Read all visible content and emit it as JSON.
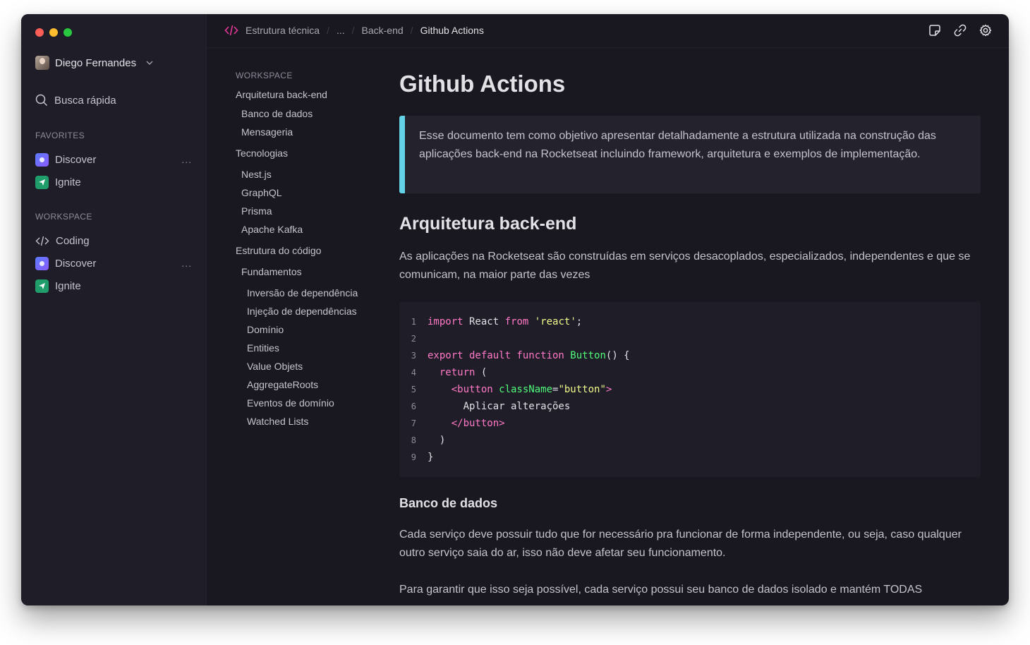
{
  "sidebar": {
    "user_name": "Diego Fernandes",
    "search_label": "Busca rápida",
    "favorites_label": "FAVORITES",
    "favorites": [
      {
        "label": "Discover",
        "icon": "discover-icon",
        "more": "..."
      },
      {
        "label": "Ignite",
        "icon": "ignite-icon"
      }
    ],
    "workspace_label": "WORKSPACE",
    "workspace": [
      {
        "label": "Coding",
        "icon": "code-icon"
      },
      {
        "label": "Discover",
        "icon": "discover-icon",
        "more": "..."
      },
      {
        "label": "Ignite",
        "icon": "ignite-icon"
      }
    ]
  },
  "topbar": {
    "breadcrumb": [
      "Estrutura técnica",
      "...",
      "Back-end",
      "Github Actions"
    ],
    "separator": "/",
    "actions": [
      "note-icon",
      "link-icon",
      "gear-icon"
    ]
  },
  "toc": {
    "label": "WORKSPACE",
    "items": [
      "Arquitetura back-end",
      "Banco de dados",
      "Mensageria",
      "Tecnologias",
      "Nest.js",
      "GraphQL",
      "Prisma",
      "Apache Kafka",
      "Estrutura do código",
      "Fundamentos",
      "Inversão de dependência",
      "Injeção de dependências",
      "Domínio",
      "Entities",
      "Value Objets",
      "AggregateRoots",
      "Eventos de domínio",
      "Watched Lists"
    ]
  },
  "content": {
    "title": "Github Actions",
    "callout": "Esse documento tem como objetivo apresentar detalhadamente a estrutura utilizada na construção das aplicações back-end na Rocketseat incluindo framework, arquitetura e exemplos de implementação.",
    "section_title": "Arquitetura back-end",
    "section_text": "As aplicações na Rocketseat são construídas em serviços desacoplados, especializados, independentes e que se comunicam, na maior parte das vezes",
    "code": {
      "line_numbers": [
        "1",
        "2",
        "3",
        "4",
        "5",
        "6",
        "7",
        "8",
        "9"
      ],
      "l1_import": "import",
      "l1_react": " React ",
      "l1_from": "from",
      "l1_str": " 'react'",
      "l1_end": ";",
      "l3_export": "export default function",
      "l3_fn": " Button",
      "l3_end": "() {",
      "l4_return": "  return",
      "l4_end": " (",
      "l5_open": "    <button",
      "l5_attr": " className",
      "l5_eq": "=",
      "l5_str": "\"button\"",
      "l5_close": ">",
      "l6_text": "      Aplicar alterações",
      "l7_close": "    </button>",
      "l8_text": "  )",
      "l9_text": "}"
    },
    "subsection_title": "Banco de dados",
    "subsection_text": "Cada serviço deve possuir tudo que for necessário pra funcionar de forma independente, ou seja, caso qualquer outro serviço saia do ar, isso não deve afetar seu funcionamento.",
    "last_text": "Para garantir que isso seja possível, cada serviço possui seu banco de dados isolado e mantém TODAS"
  }
}
